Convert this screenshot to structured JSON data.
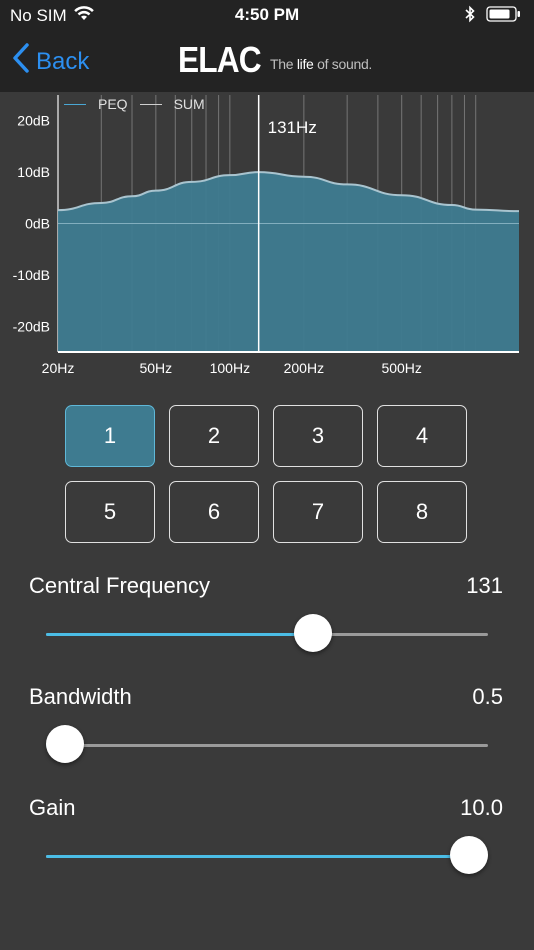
{
  "status_bar": {
    "carrier": "No SIM",
    "time": "4:50 PM"
  },
  "nav": {
    "back_label": "Back",
    "logo_text": "ELAC",
    "tagline_prefix": "The ",
    "tagline_bold": "life",
    "tagline_suffix": " of sound."
  },
  "chart_data": {
    "type": "area",
    "legend": [
      "PEQ",
      "SUM"
    ],
    "x_tick_labels": [
      "20Hz",
      "50Hz",
      "100Hz",
      "200Hz",
      "500Hz"
    ],
    "x_tick_values": [
      20,
      50,
      100,
      200,
      500
    ],
    "y_tick_labels": [
      "20dB",
      "10dB",
      "0dB",
      "-10dB",
      "-20dB"
    ],
    "y_tick_values": [
      20,
      10,
      0,
      -10,
      -20
    ],
    "x_scale": "log",
    "xlim": [
      20,
      1500
    ],
    "ylim": [
      -25,
      25
    ],
    "marker_label": "131Hz",
    "marker_x": 131,
    "series": [
      {
        "name": "PEQ",
        "x": [
          20,
          30,
          40,
          50,
          70,
          100,
          131,
          200,
          300,
          500,
          800,
          1000,
          1500
        ],
        "y": [
          2.6,
          4.0,
          5.3,
          6.4,
          8.1,
          9.4,
          10.0,
          9.1,
          7.6,
          5.5,
          3.6,
          2.7,
          2.4
        ]
      }
    ]
  },
  "bands": {
    "active": "1",
    "labels": [
      "1",
      "2",
      "3",
      "4",
      "5",
      "6",
      "7",
      "8"
    ]
  },
  "params": {
    "freq_label": "Central Frequency",
    "freq_value": "131",
    "freq_fraction": 0.605,
    "bw_label": "Bandwidth",
    "bw_value": "0.5",
    "bw_fraction": 0.043,
    "gain_label": "Gain",
    "gain_value": "10.0",
    "gain_fraction": 0.957
  },
  "colors": {
    "accent": "#2c8ff0",
    "slider_fill": "#4bbde6",
    "area_fill": "#3e7b90",
    "curve": "#a9c4cf"
  }
}
